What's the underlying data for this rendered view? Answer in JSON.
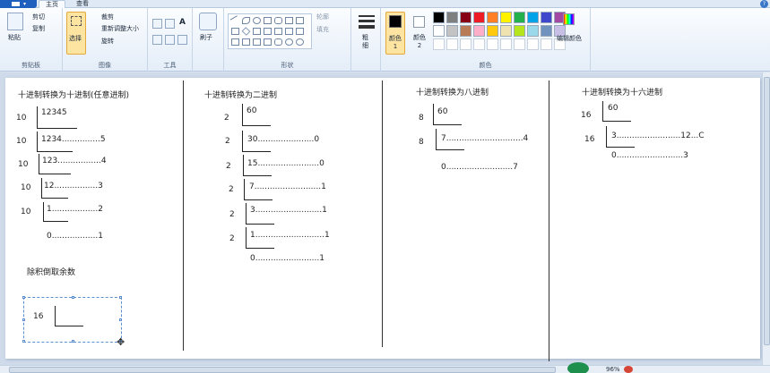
{
  "tabs": {
    "home": "主页",
    "view": "查看"
  },
  "clipboard": {
    "paste": "粘贴",
    "cut": "剪切",
    "copy": "复制",
    "label": "剪贴板"
  },
  "image": {
    "select": "选择",
    "crop": "裁剪",
    "resize": "重新调整大小",
    "rotate": "旋转",
    "label": "图像"
  },
  "tools": {
    "label": "工具"
  },
  "brushes": {
    "label": "刷子"
  },
  "shapes": {
    "outline": "轮廓",
    "fill": "填充",
    "label": "形状"
  },
  "size": {
    "label1": "粗",
    "label2": "细"
  },
  "colors": {
    "color1": "颜色 1",
    "color2": "颜色 2",
    "edit": "编辑颜色",
    "label": "颜色",
    "palette_row1": [
      "#000000",
      "#7f7f7f",
      "#880015",
      "#ed1c24",
      "#ff7f27",
      "#fff200",
      "#22b14c",
      "#00a2e8",
      "#3f48cc",
      "#a349a4"
    ],
    "palette_row2": [
      "#ffffff",
      "#c3c3c3",
      "#b97a57",
      "#ffaec9",
      "#ffc90e",
      "#efe4b0",
      "#b5e61d",
      "#99d9ea",
      "#7092be",
      "#c8bfe7"
    ]
  },
  "taskbar": {
    "label": "96%"
  },
  "canvas": {
    "sec1": {
      "title": "十进制转换为十进制(任意进制)",
      "divisors": [
        "10",
        "10",
        "10",
        "10",
        "10"
      ],
      "rows": [
        "12345",
        "1234...............5",
        "123.................4",
        "12.................3",
        "1..................2"
      ],
      "final": "0..................1"
    },
    "note": "除积倒取余数",
    "sel": {
      "divisor": "16"
    },
    "sec2": {
      "title": "十进制转换为二进制",
      "divisors": [
        "2",
        "2",
        "2",
        "2",
        "2",
        "2"
      ],
      "rows": [
        "60",
        "30......................0",
        "15........................0",
        "7..........................1",
        "3..........................1",
        "1...........................1"
      ],
      "final": "0.........................1"
    },
    "sec3": {
      "title": "十进制转换为八进制",
      "divisors": [
        "8",
        "8"
      ],
      "rows": [
        "60",
        "7..............................4"
      ],
      "final": "0..........................7"
    },
    "sec4": {
      "title": "十进制转换为十六进制",
      "divisors": [
        "16",
        "16"
      ],
      "rows": [
        "60",
        "3.........................12...C"
      ],
      "final": "0..........................3"
    }
  }
}
